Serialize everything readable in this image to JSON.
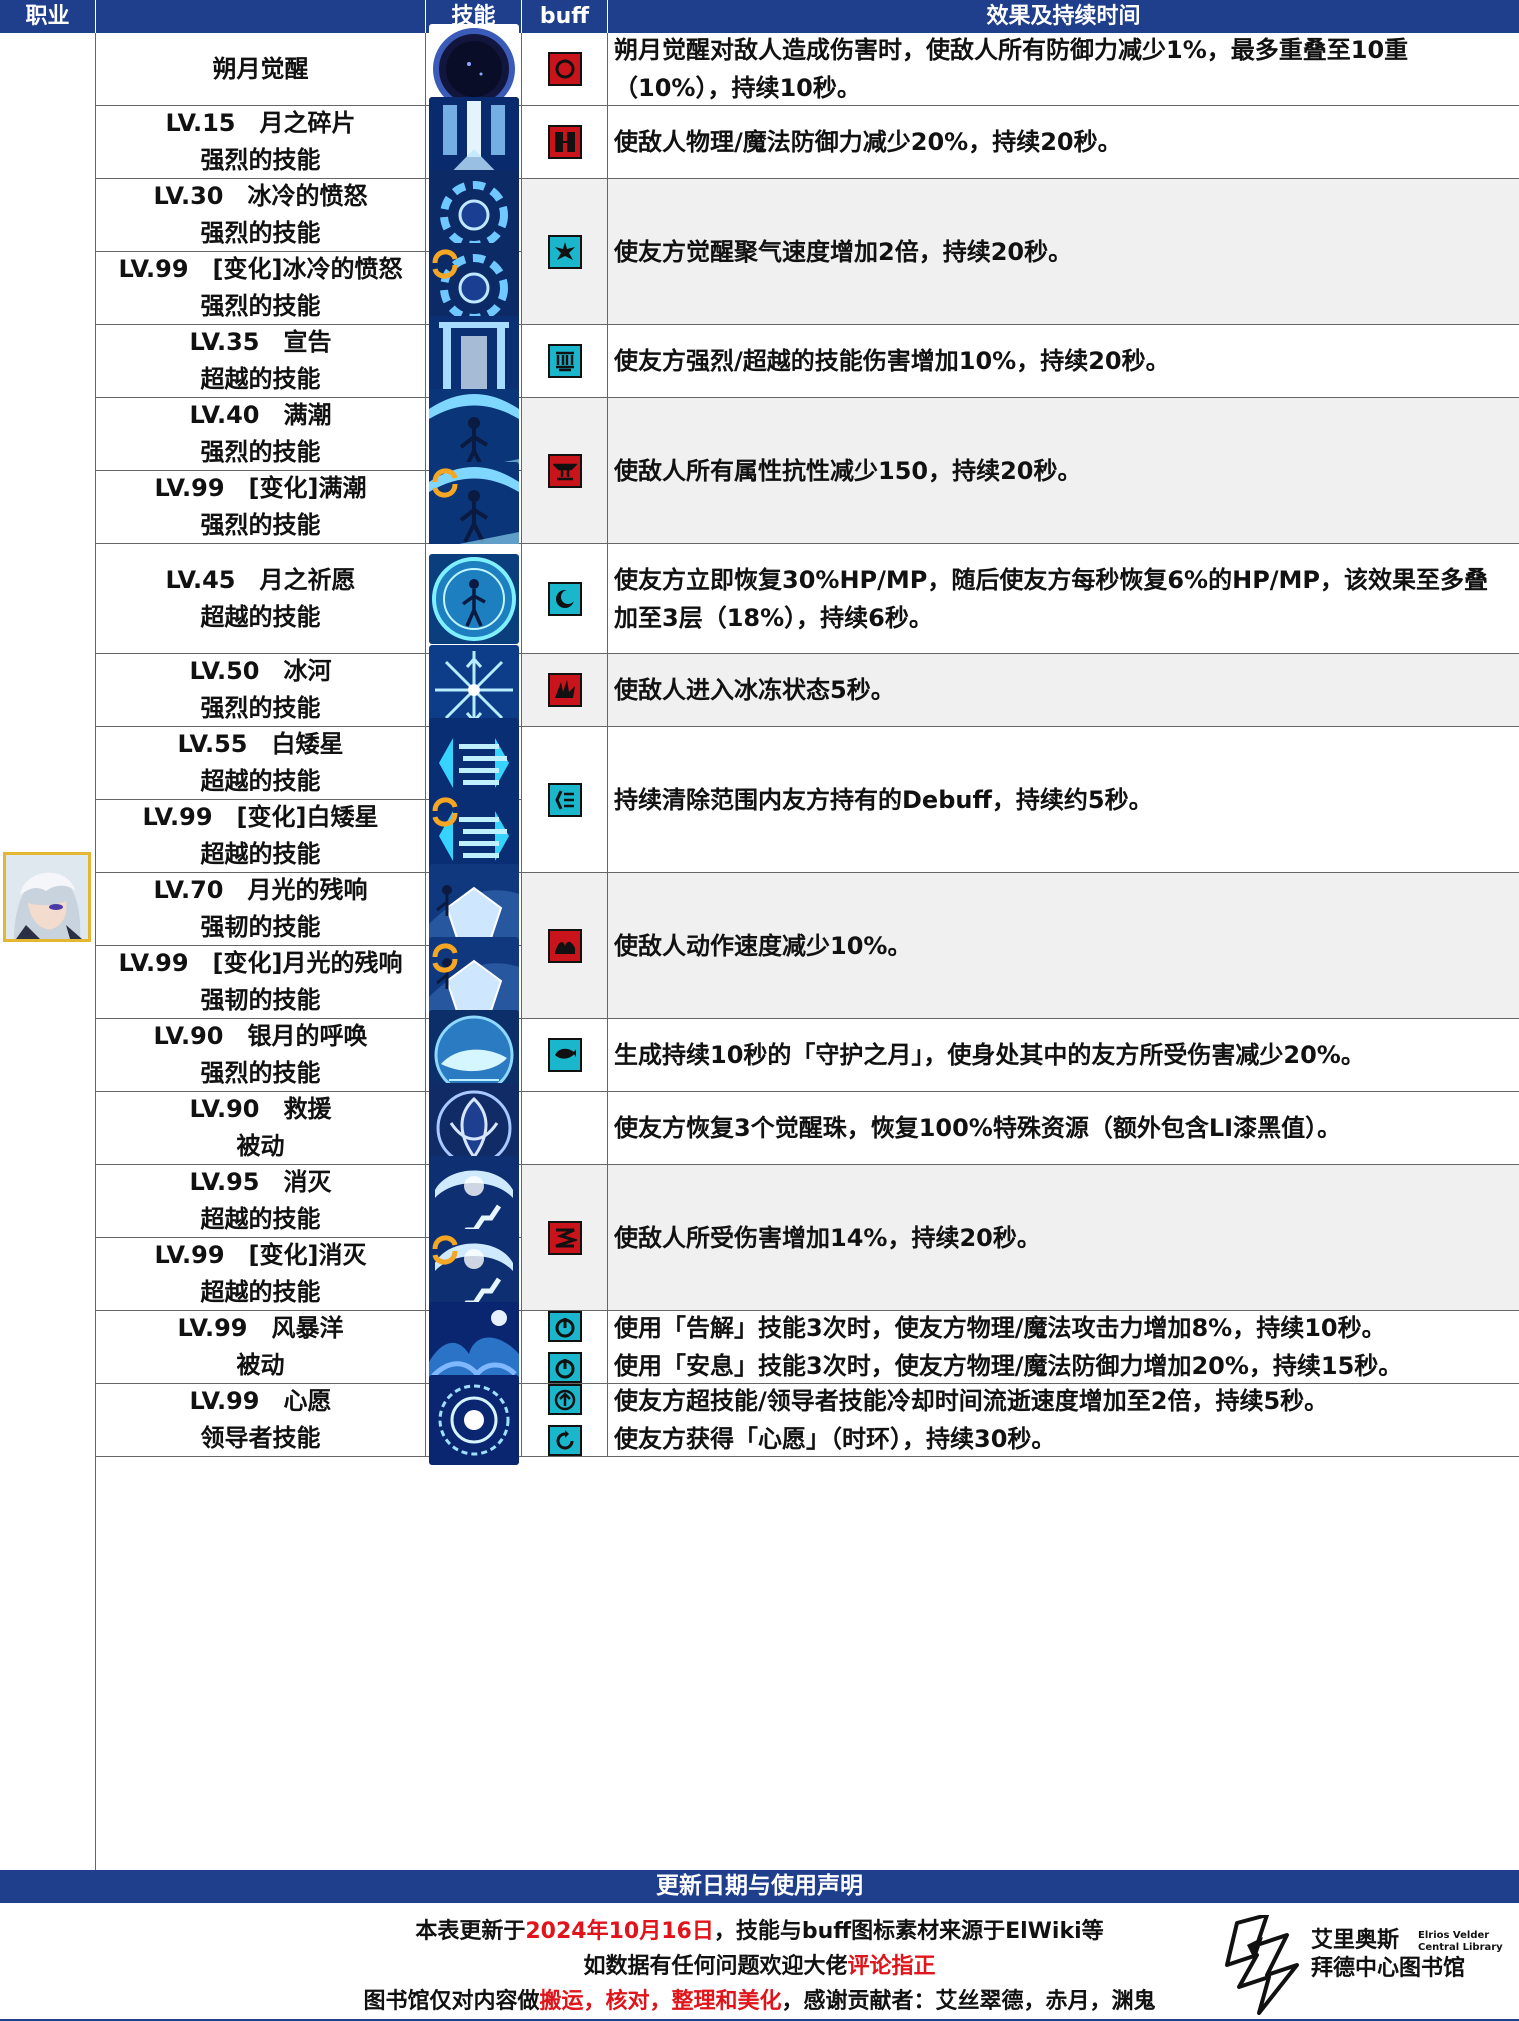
{
  "header": {
    "job": "职业",
    "skill_name": "",
    "skill_icon": "技能",
    "buff": "buff",
    "effect": "效果及持续时间"
  },
  "rows": [
    {
      "lines": [
        "朔月觉醒"
      ],
      "effect": [
        "朔月觉醒对敌人造成伤害时，使敌人所有防御力减少1%，最多重叠至10重（10%），持续10秒。"
      ]
    },
    {
      "lines": [
        "LV.15　月之碎片",
        "强烈的技能"
      ],
      "effect": [
        "使敌人物理/魔法防御力减少20%，持续20秒。"
      ]
    },
    {
      "lines": [
        "LV.30　冰冷的愤怒",
        "强烈的技能"
      ]
    },
    {
      "lines": [
        "LV.99　[变化]冰冷的愤怒",
        "强烈的技能"
      ],
      "effect": [
        "使友方觉醒聚气速度增加2倍，持续20秒。"
      ]
    },
    {
      "lines": [
        "LV.35　宣告",
        "超越的技能"
      ],
      "effect": [
        "使友方强烈/超越的技能伤害增加10%，持续20秒。"
      ]
    },
    {
      "lines": [
        "LV.40　满潮",
        "强烈的技能"
      ]
    },
    {
      "lines": [
        "LV.99　[变化]满潮",
        "强烈的技能"
      ],
      "effect": [
        "使敌人所有属性抗性减少150，持续20秒。"
      ]
    },
    {
      "lines": [
        "LV.45　月之祈愿",
        "超越的技能"
      ],
      "effect": [
        "使友方立即恢复30%HP/MP，随后使友方每秒恢复6%的HP/MP，该效果至多叠加至3层（18%），持续6秒。"
      ]
    },
    {
      "lines": [
        "LV.50　冰河",
        "强烈的技能"
      ],
      "effect": [
        "使敌人进入冰冻状态5秒。"
      ]
    },
    {
      "lines": [
        "LV.55　白矮星",
        "超越的技能"
      ]
    },
    {
      "lines": [
        "LV.99　[变化]白矮星",
        "超越的技能"
      ],
      "effect": [
        "持续清除范围内友方持有的Debuff，持续约5秒。"
      ]
    },
    {
      "lines": [
        "LV.70　月光的残响",
        "强韧的技能"
      ]
    },
    {
      "lines": [
        "LV.99　[变化]月光的残响",
        "强韧的技能"
      ],
      "effect": [
        "使敌人动作速度减少10%。"
      ]
    },
    {
      "lines": [
        "LV.90　银月的呼唤",
        "强烈的技能"
      ],
      "effect": [
        "生成持续10秒的「守护之月」，使身处其中的友方所受伤害减少20%。"
      ]
    },
    {
      "lines": [
        "LV.90　救援",
        "被动"
      ],
      "effect": [
        "使友方恢复3个觉醒珠，恢复100%特殊资源（额外包含LI漆黑值）。"
      ]
    },
    {
      "lines": [
        "LV.95　消灭",
        "超越的技能"
      ]
    },
    {
      "lines": [
        "LV.99　[变化]消灭",
        "超越的技能"
      ],
      "effect": [
        "使敌人所受伤害增加14%，持续20秒。"
      ]
    },
    {
      "lines": [
        "LV.99　风暴洋",
        "被动"
      ],
      "effect": [
        "使用「告解」技能3次时，使友方物理/魔法攻击力增加8%，持续10秒。",
        "使用「安息」技能3次时，使友方物理/魔法防御力增加20%，持续15秒。"
      ]
    },
    {
      "lines": [
        "LV.99　心愿",
        "领导者技能"
      ],
      "effect": [
        "使友方超技能/领导者技能冷却时间流逝速度增加至2倍，持续5秒。",
        "使友方获得「心愿」（时环），持续30秒。"
      ]
    }
  ],
  "footer": {
    "title": "更新日期与使用声明",
    "line1_a": "本表更新于",
    "line1_date": "2024年10月16日",
    "line1_b": "，技能与buff图标素材来源于ElWiki等",
    "line2_a": "如数据有任何问题欢迎大佬",
    "line2_red": "评论指正",
    "line3_a": "图书馆仅对内容做",
    "line3_red": "搬运，核对，整理和美化",
    "line3_b": "，感谢贡献者：艾丝翠德，赤月，渊鬼",
    "logo_zh_1": "艾里奥斯",
    "logo_zh_2": "拜德中心图书馆",
    "logo_en_1": "Elrios Velder",
    "logo_en_2": "Central Library"
  },
  "colors": {
    "header": "#1f3e8c",
    "debuff": "#c8141a",
    "buff": "#1ab7cc",
    "highlight": "#e0141a"
  }
}
